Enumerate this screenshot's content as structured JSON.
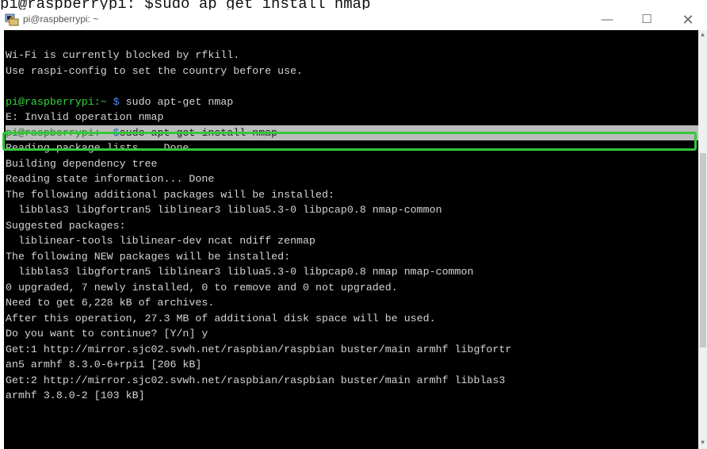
{
  "caption": "pi@raspberrypi: $sudo ap get install nmap",
  "window": {
    "title": "pi@raspberrypi: ~",
    "minimize_label": "—",
    "maximize_label": "☐",
    "close_label": "✕"
  },
  "terminal": {
    "lines": [
      {
        "text": "Wi-Fi is currently blocked by rfkill."
      },
      {
        "text": "Use raspi-config to set the country before use."
      },
      {
        "text": ""
      },
      {
        "prompt": "pi@raspberrypi:~",
        "dollar": " $",
        "text": " sudo apt-get nmap"
      },
      {
        "text": "E: Invalid operation nmap"
      },
      {
        "prompt": "pi@raspberrypi:~",
        "dollar": " $",
        "text": "sudo apt-get install nmap",
        "selected": true
      },
      {
        "text": "Reading package lists... Done"
      },
      {
        "text": "Building dependency tree"
      },
      {
        "text": "Reading state information... Done"
      },
      {
        "text": "The following additional packages will be installed:"
      },
      {
        "text": "  libblas3 libgfortran5 liblinear3 liblua5.3-0 libpcap0.8 nmap-common"
      },
      {
        "text": "Suggested packages:"
      },
      {
        "text": "  liblinear-tools liblinear-dev ncat ndiff zenmap"
      },
      {
        "text": "The following NEW packages will be installed:"
      },
      {
        "text": "  libblas3 libgfortran5 liblinear3 liblua5.3-0 libpcap0.8 nmap nmap-common"
      },
      {
        "text": "0 upgraded, 7 newly installed, 0 to remove and 0 not upgraded."
      },
      {
        "text": "Need to get 6,228 kB of archives."
      },
      {
        "text": "After this operation, 27.3 MB of additional disk space will be used."
      },
      {
        "text": "Do you want to continue? [Y/n] y"
      },
      {
        "text": "Get:1 http://mirror.sjc02.svwh.net/raspbian/raspbian buster/main armhf libgfortr"
      },
      {
        "text": "an5 armhf 8.3.0-6+rpi1 [206 kB]"
      },
      {
        "text": "Get:2 http://mirror.sjc02.svwh.net/raspbian/raspbian buster/main armhf libblas3"
      },
      {
        "text": "armhf 3.8.0-2 [103 kB]"
      }
    ]
  },
  "scrollbar": {
    "up_label": "▲",
    "down_label": "▼"
  }
}
